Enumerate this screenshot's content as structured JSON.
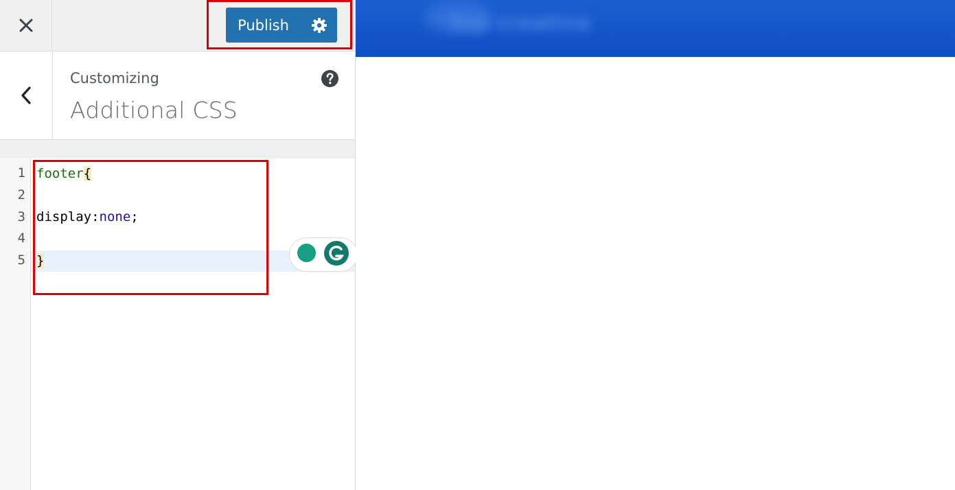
{
  "topbar": {
    "close_icon": "close-icon",
    "publish_label": "Publish",
    "publish_settings_icon": "gear-icon"
  },
  "section": {
    "back_icon": "chevron-left-icon",
    "breadcrumb": "Customizing",
    "title": "Additional CSS",
    "help_icon": "help-icon"
  },
  "editor": {
    "line_numbers": [
      "1",
      "2",
      "3",
      "4",
      "5"
    ],
    "lines": {
      "l1_selector": "footer",
      "l1_brace": "{",
      "l3_property": "display",
      "l3_colon": ":",
      "l3_value": "none",
      "l3_semicolon": ";",
      "l5_brace": "}"
    },
    "active_line": 5
  },
  "preview": {
    "brand_text": "top creative"
  },
  "colors": {
    "accent": "#2271b1",
    "highlight": "#e00000",
    "preview_header": "#1357cc"
  }
}
